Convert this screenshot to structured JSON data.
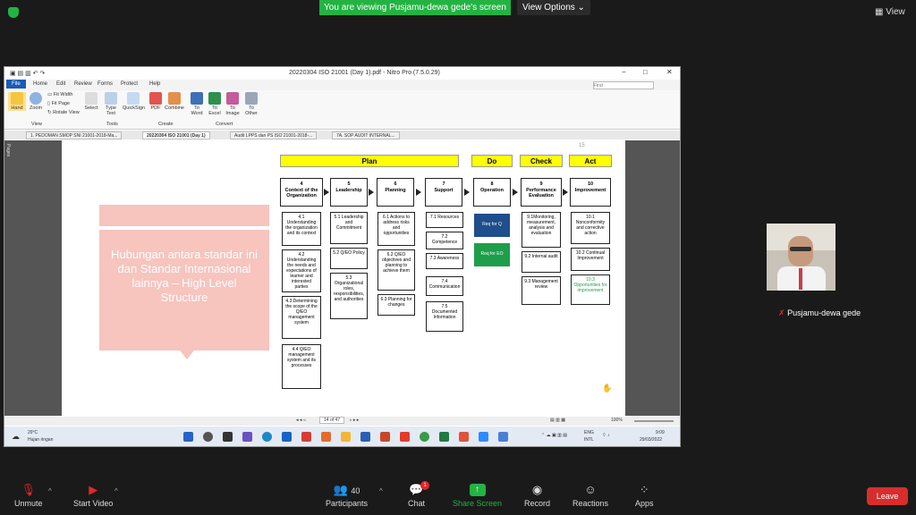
{
  "zoom": {
    "share_banner": "You are viewing Pusjamu-dewa gede's screen",
    "view_options": "View Options",
    "view_button": "View"
  },
  "nitro": {
    "title": "20220304 ISO 21001 (Day 1).pdf - Nitro Pro (7.5.0.29)",
    "ribbon_tabs": [
      "File",
      "Home",
      "Edit",
      "Review",
      "Forms",
      "Protect",
      "Help"
    ],
    "find_placeholder": "Find",
    "ribbon_buttons": [
      "Hand",
      "Zoom",
      "Fit Width",
      "Fit Page",
      "Rotate View",
      "Select",
      "Type Text",
      "QuickSign",
      "PDF",
      "Combine",
      "To Word",
      "To Excel",
      "To Image",
      "To Other"
    ],
    "ribbon_groups": [
      "View",
      "Tools",
      "Create",
      "Convert"
    ],
    "doc_tabs": [
      "1. PEDOMAN SMOP SNI 21001-2018-Ma...",
      "20220304 ISO 21001 (Day 1)",
      "Audit LPPS dan PS ISO 21001-2018-...",
      "7A. SOP AUDIT INTERNAL..."
    ],
    "side_label": "Pages",
    "status": {
      "page": "14 of 47",
      "zoom": "100%"
    }
  },
  "slide": {
    "page_number": "15",
    "pink_text": "Hubungan antara standar ini dan Standar Internasional lainnya – High Level Structure",
    "phases": [
      "Plan",
      "Do",
      "Check",
      "Act"
    ],
    "headers": [
      {
        "num": "4",
        "label": "Context of the Organization"
      },
      {
        "num": "5",
        "label": "Leadership"
      },
      {
        "num": "6",
        "label": "Planning"
      },
      {
        "num": "7",
        "label": "Support"
      },
      {
        "num": "8",
        "label": "Operation"
      },
      {
        "num": "9",
        "label": "Performance Evaluation"
      },
      {
        "num": "10",
        "label": "Improvement"
      }
    ],
    "col4": [
      "4.1 Understanding the organization and its context",
      "4.2 Understanding the needs and expectations of learner and interested parties",
      "4.3 Determining the scope of the Q/EO management system",
      "4.4 Q/EO management system and its processes"
    ],
    "col5": [
      "5.1 Leadership and Commitment",
      "5.2 Q/EO Policy",
      "5.3 Organizational roles, responsibilities, and authorities"
    ],
    "col6": [
      "6.1 Actions to address risks and opportunities",
      "6.2 Q/EO objectives and planning to achieve them",
      "6.3 Planning for changes"
    ],
    "col7": [
      "7.1 Resources",
      "7.2 Competence",
      "7.3 Awareness",
      "7.4 Communication",
      "7.5 Documented Information"
    ],
    "col8": [
      "Req for Q",
      "Req for EO"
    ],
    "col9": [
      "9.1Monitoring, measurement, analysis and evaluation",
      "9.2 Internal audit",
      "9.3 Management review"
    ],
    "col10": [
      "10.1 Nonconformity and corrective action",
      "10.2 Continual Improvement",
      "10.3 Opportunities for improvement"
    ]
  },
  "taskbar": {
    "weather_temp": "29°C",
    "weather_desc": "Hujan ringan",
    "lang": "ENG",
    "lang2": "INTL",
    "time": "9:09",
    "date": "29/03/2022"
  },
  "participant": {
    "name": "Pusjamu-dewa gede"
  },
  "toolbar": {
    "unmute": "Unmute",
    "start_video": "Start Video",
    "participants": "Participants",
    "participant_count": "40",
    "chat": "Chat",
    "chat_badge": "1",
    "share_screen": "Share Screen",
    "record": "Record",
    "reactions": "Reactions",
    "apps": "Apps",
    "leave": "Leave"
  },
  "colors": {
    "zoom_green": "#23b343",
    "leave_red": "#d92d2d",
    "phase_yellow": "#ffff00",
    "req_q_blue": "#1f4e8c",
    "req_eo_green": "#1e9e4a"
  }
}
